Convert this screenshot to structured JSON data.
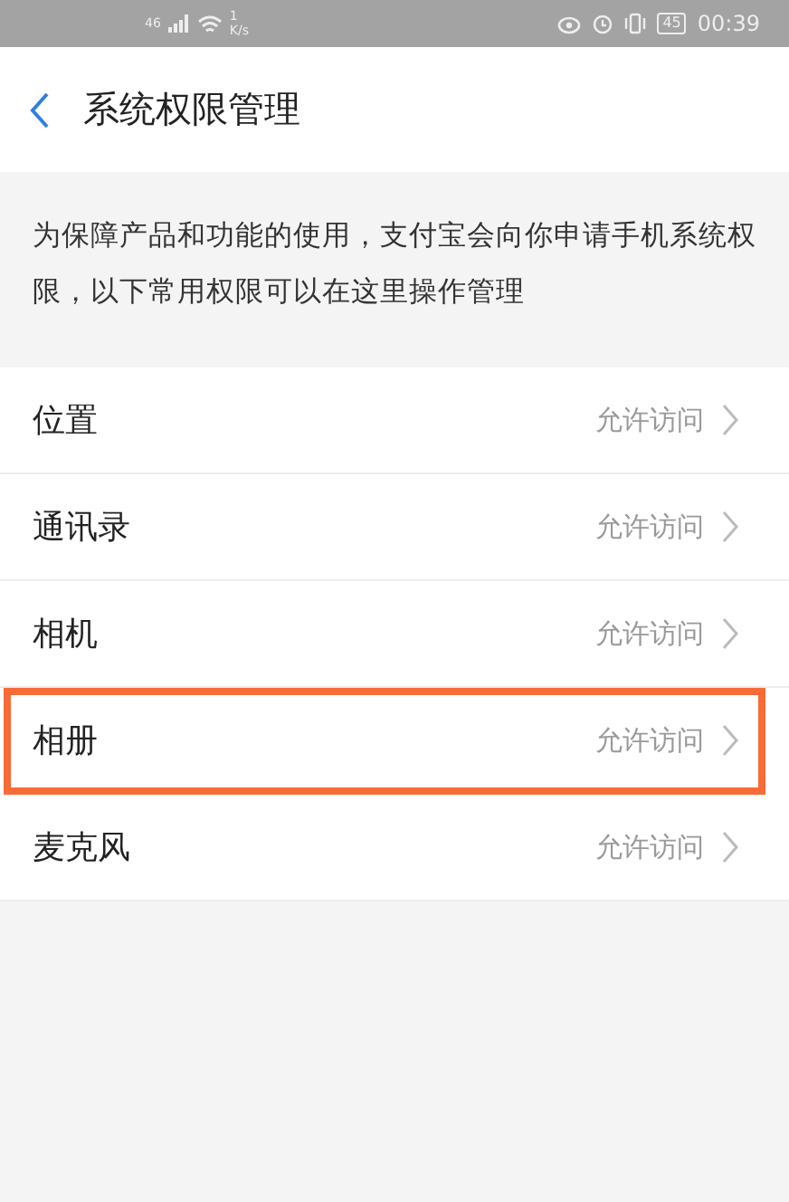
{
  "status_bar": {
    "network": "46",
    "speed": "1",
    "speed_unit": "K/s",
    "battery": "45",
    "time": "00:39"
  },
  "header": {
    "title": "系统权限管理"
  },
  "description": "为保障产品和功能的使用，支付宝会向你申请手机系统权限，以下常用权限可以在这里操作管理",
  "permissions": [
    {
      "name": "位置",
      "status": "允许访问",
      "highlighted": false
    },
    {
      "name": "通讯录",
      "status": "允许访问",
      "highlighted": false
    },
    {
      "name": "相机",
      "status": "允许访问",
      "highlighted": false
    },
    {
      "name": "相册",
      "status": "允许访问",
      "highlighted": true
    },
    {
      "name": "麦克风",
      "status": "允许访问",
      "highlighted": false
    }
  ]
}
